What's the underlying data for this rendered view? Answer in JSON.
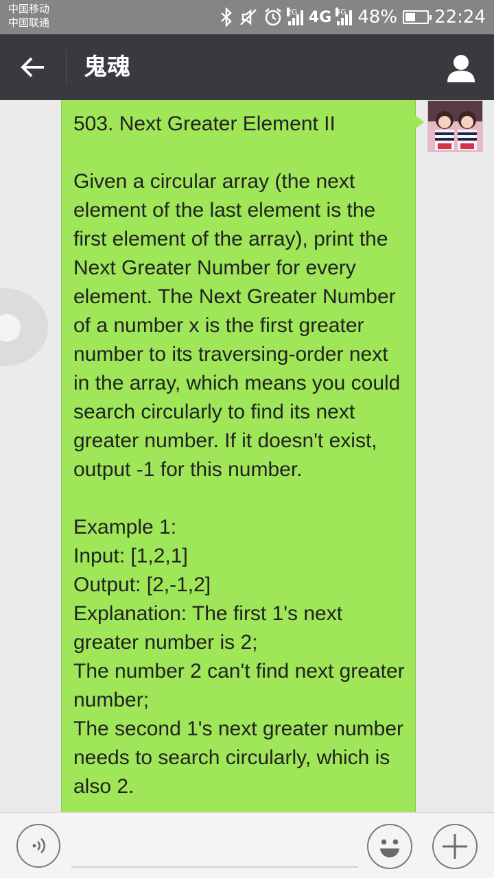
{
  "status_bar": {
    "carrier_1": "中国移动",
    "carrier_2": "中国联通",
    "sim1_network_tag": "2G",
    "sim2_network": "4G",
    "sim2_network_tag": "4G",
    "battery_percent": "48%",
    "battery_level": 0.48,
    "time": "22:24"
  },
  "header": {
    "back_icon": "arrow-left-icon",
    "title": "鬼魂",
    "profile_icon": "person-icon"
  },
  "message": {
    "avatar_icon": "avatar-photo",
    "text": "503. Next Greater Element II\n\nGiven a circular array (the next element of the last element is the first element of the array), print the Next Greater Number for every element. The Next Greater Number of a number x is the first greater number to its traversing-order next in the array, which means you could search circularly to find its next greater number. If it doesn't exist, output -1 for this number.\n\nExample 1:\nInput: [1,2,1]\nOutput: [2,-1,2]\nExplanation: The first 1's next greater number is 2;\nThe number 2 can't find next greater number;\nThe second 1's next greater number needs to search circularly, which is also 2."
  },
  "input_bar": {
    "voice_icon": "voice-icon",
    "input_value": "",
    "emoji_icon": "smiley-icon",
    "plus_icon": "plus-icon"
  },
  "colors": {
    "status_bar_bg": "#858585",
    "header_bg": "#393a3f",
    "bubble_bg": "#9fe658",
    "chat_bg": "#ebebeb"
  }
}
